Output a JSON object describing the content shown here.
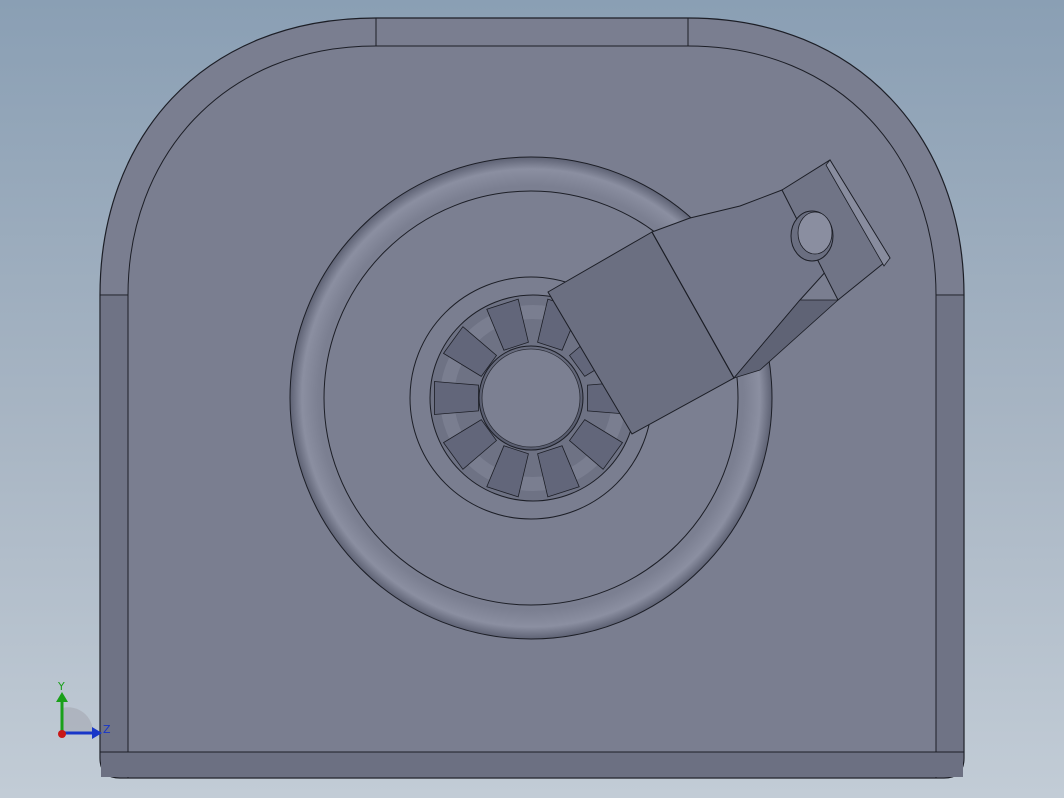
{
  "viewport": {
    "background_top": "#8a9fb4",
    "background_bottom": "#c2ccd6"
  },
  "model": {
    "face_color": "#7a7e90",
    "edge_color": "#1c1e26",
    "shade_color": "#6a6e80"
  },
  "triad": {
    "y_label": "Y",
    "z_label": "Z",
    "y_color": "#1aa01a",
    "z_color": "#1836c8",
    "x_color": "#c81818"
  }
}
